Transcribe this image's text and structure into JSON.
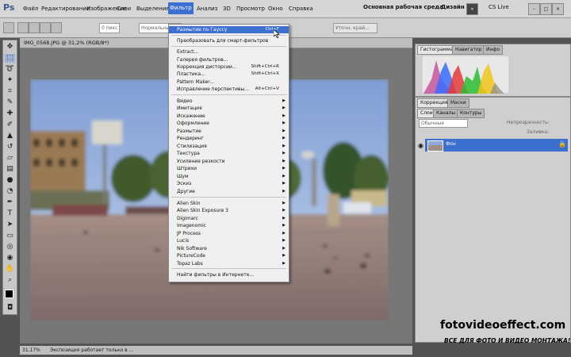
{
  "app": {
    "logo": "Ps"
  },
  "menubar": {
    "items": [
      "Файл",
      "Редактирование",
      "Изображение",
      "Слои",
      "Выделение",
      "Фильтр",
      "Анализ",
      "3D",
      "Просмотр",
      "Окно",
      "Справка"
    ],
    "zoom": "31,2",
    "workspace": "Основная рабочая среда",
    "design": "Дизайн",
    "cslive": "CS Live"
  },
  "optionsbar": {
    "mode_value": "Нормальный",
    "feather_value": "0 пикс",
    "refine_edge": "Уточн. край..."
  },
  "document": {
    "tab_title": "IMG_0568.JPG @ 31,2% (RGB/8*)",
    "status_zoom": "31,17%",
    "status_text": "Экспозиция работает только в ..."
  },
  "filter_menu": {
    "items": [
      {
        "label": "Размытие по Гауссу",
        "shortcut": "Ctrl+F"
      },
      {
        "label": "Преобразовать для смарт-фильтров"
      },
      {
        "label": "Extract..."
      },
      {
        "label": "Галерея фильтров..."
      },
      {
        "label": "Коррекция дисторсии...",
        "shortcut": "Shift+Ctrl+R"
      },
      {
        "label": "Пластика...",
        "shortcut": "Shift+Ctrl+X"
      },
      {
        "label": "Pattern Maker..."
      },
      {
        "label": "Исправление перспективы...",
        "shortcut": "Alt+Ctrl+V"
      },
      {
        "label": "Видео"
      },
      {
        "label": "Имитация"
      },
      {
        "label": "Искажение"
      },
      {
        "label": "Оформление"
      },
      {
        "label": "Размытие"
      },
      {
        "label": "Рендеринг"
      },
      {
        "label": "Стилизация"
      },
      {
        "label": "Текстура"
      },
      {
        "label": "Усиление резкости"
      },
      {
        "label": "Штрихи"
      },
      {
        "label": "Шум"
      },
      {
        "label": "Эскиз"
      },
      {
        "label": "Другие"
      },
      {
        "label": "Alien Skin"
      },
      {
        "label": "Alien Skin Exposure 3"
      },
      {
        "label": "Digimarc"
      },
      {
        "label": "Imagenomic"
      },
      {
        "label": "JP Process"
      },
      {
        "label": "Lucis"
      },
      {
        "label": "Nik Software"
      },
      {
        "label": "PictureCode"
      },
      {
        "label": "Topaz Labs"
      },
      {
        "label": "Найти фильтры в Интернете..."
      }
    ]
  },
  "panels": {
    "histogram_tabs": [
      "Гистограмма",
      "Навигатор",
      "Инфо"
    ],
    "correction_tabs": [
      "Коррекция",
      "Маски"
    ],
    "layers_tabs": [
      "Слои",
      "Каналы",
      "Контуры"
    ],
    "blend_mode": "Обычные",
    "opacity_label": "Непрозрачность:",
    "fill_label": "Заливка:",
    "layer_name": "Фон"
  },
  "watermark": {
    "site": "fotovideoeffect.com",
    "tagline": "ВСЕ ДЛЯ ФОТО И ВИДЕО МОНТАЖА!"
  },
  "colors": {
    "highlight": "#3d6fd1",
    "menubar": "#d6d6d6",
    "workspace": "#535353"
  }
}
